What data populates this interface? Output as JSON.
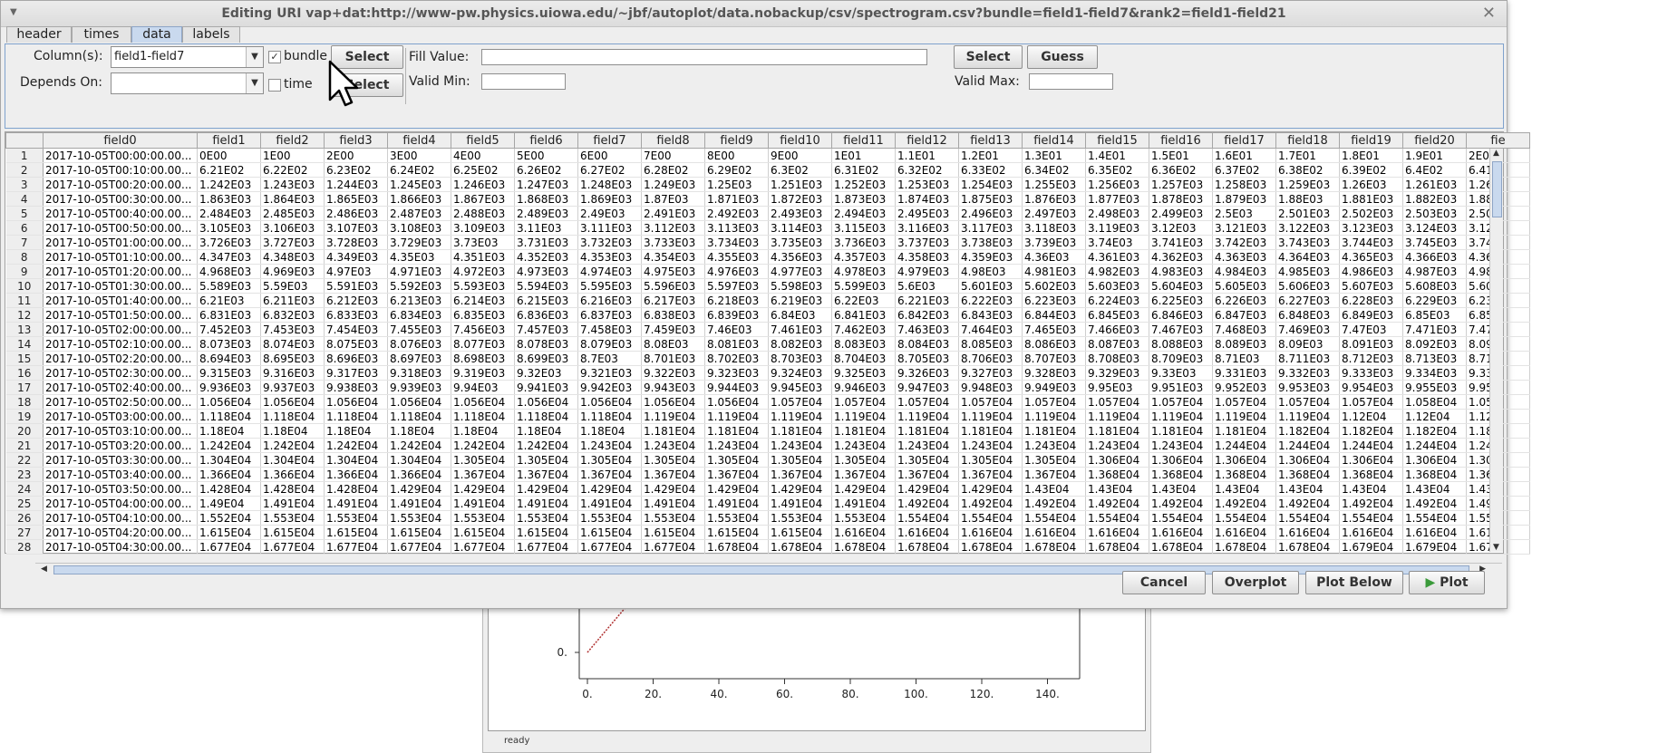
{
  "background_window": {
    "y_tick": "0.",
    "x_ticks": [
      "0.",
      "20.",
      "40.",
      "60.",
      "80.",
      "100.",
      "120.",
      "140."
    ],
    "status": "ready"
  },
  "dialog": {
    "title": "Editing URI vap+dat:http://www-pw.physics.uiowa.edu/~jbf/autoplot/data.nobackup/csv/spectrogram.csv?bundle=field1-field7&rank2=field1-field21",
    "tabs": [
      "header",
      "times",
      "data",
      "labels"
    ],
    "active_tab": "data",
    "columns_label": "Column(s):",
    "columns_value": "field1-field7",
    "bundle_label": "bundle",
    "bundle_checked": true,
    "select_label": "Select",
    "select2_label": "Select",
    "depends_on_label": "Depends On:",
    "depends_on_value": "",
    "time_label": "time",
    "time_checked": false,
    "fill_value_label": "Fill Value:",
    "fill_value": "",
    "fill_select_label": "Select",
    "guess_label": "Guess",
    "valid_min_label": "Valid Min:",
    "valid_max_label": "Valid Max:",
    "cancel_label": "Cancel",
    "overplot_label": "Overplot",
    "plot_below_label": "Plot Below",
    "plot_label": "Plot",
    "accent_color": "#c9d9ee"
  },
  "table": {
    "headers": [
      "field0",
      "field1",
      "field2",
      "field3",
      "field4",
      "field5",
      "field6",
      "field7",
      "field8",
      "field9",
      "field10",
      "field11",
      "field12",
      "field13",
      "field14",
      "field15",
      "field16",
      "field17",
      "field18",
      "field19",
      "field20",
      "fie"
    ],
    "rows": [
      [
        "2017-10-05T00:00:00.00...",
        "0E00",
        "1E00",
        "2E00",
        "3E00",
        "4E00",
        "5E00",
        "6E00",
        "7E00",
        "8E00",
        "9E00",
        "1E01",
        "1.1E01",
        "1.2E01",
        "1.3E01",
        "1.4E01",
        "1.5E01",
        "1.6E01",
        "1.7E01",
        "1.8E01",
        "1.9E01",
        "2E0"
      ],
      [
        "2017-10-05T00:10:00.00...",
        "6.21E02",
        "6.22E02",
        "6.23E02",
        "6.24E02",
        "6.25E02",
        "6.26E02",
        "6.27E02",
        "6.28E02",
        "6.29E02",
        "6.3E02",
        "6.31E02",
        "6.32E02",
        "6.33E02",
        "6.34E02",
        "6.35E02",
        "6.36E02",
        "6.37E02",
        "6.38E02",
        "6.39E02",
        "6.4E02",
        "6.41"
      ],
      [
        "2017-10-05T00:20:00.00...",
        "1.242E03",
        "1.243E03",
        "1.244E03",
        "1.245E03",
        "1.246E03",
        "1.247E03",
        "1.248E03",
        "1.249E03",
        "1.25E03",
        "1.251E03",
        "1.252E03",
        "1.253E03",
        "1.254E03",
        "1.255E03",
        "1.256E03",
        "1.257E03",
        "1.258E03",
        "1.259E03",
        "1.26E03",
        "1.261E03",
        "1.26"
      ],
      [
        "2017-10-05T00:30:00.00...",
        "1.863E03",
        "1.864E03",
        "1.865E03",
        "1.866E03",
        "1.867E03",
        "1.868E03",
        "1.869E03",
        "1.87E03",
        "1.871E03",
        "1.872E03",
        "1.873E03",
        "1.874E03",
        "1.875E03",
        "1.876E03",
        "1.877E03",
        "1.878E03",
        "1.879E03",
        "1.88E03",
        "1.881E03",
        "1.882E03",
        "1.88"
      ],
      [
        "2017-10-05T00:40:00.00...",
        "2.484E03",
        "2.485E03",
        "2.486E03",
        "2.487E03",
        "2.488E03",
        "2.489E03",
        "2.49E03",
        "2.491E03",
        "2.492E03",
        "2.493E03",
        "2.494E03",
        "2.495E03",
        "2.496E03",
        "2.497E03",
        "2.498E03",
        "2.499E03",
        "2.5E03",
        "2.501E03",
        "2.502E03",
        "2.503E03",
        "2.50"
      ],
      [
        "2017-10-05T00:50:00.00...",
        "3.105E03",
        "3.106E03",
        "3.107E03",
        "3.108E03",
        "3.109E03",
        "3.11E03",
        "3.111E03",
        "3.112E03",
        "3.113E03",
        "3.114E03",
        "3.115E03",
        "3.116E03",
        "3.117E03",
        "3.118E03",
        "3.119E03",
        "3.12E03",
        "3.121E03",
        "3.122E03",
        "3.123E03",
        "3.124E03",
        "3.12"
      ],
      [
        "2017-10-05T01:00:00.00...",
        "3.726E03",
        "3.727E03",
        "3.728E03",
        "3.729E03",
        "3.73E03",
        "3.731E03",
        "3.732E03",
        "3.733E03",
        "3.734E03",
        "3.735E03",
        "3.736E03",
        "3.737E03",
        "3.738E03",
        "3.739E03",
        "3.74E03",
        "3.741E03",
        "3.742E03",
        "3.743E03",
        "3.744E03",
        "3.745E03",
        "3.74"
      ],
      [
        "2017-10-05T01:10:00.00...",
        "4.347E03",
        "4.348E03",
        "4.349E03",
        "4.35E03",
        "4.351E03",
        "4.352E03",
        "4.353E03",
        "4.354E03",
        "4.355E03",
        "4.356E03",
        "4.357E03",
        "4.358E03",
        "4.359E03",
        "4.36E03",
        "4.361E03",
        "4.362E03",
        "4.363E03",
        "4.364E03",
        "4.365E03",
        "4.366E03",
        "4.36"
      ],
      [
        "2017-10-05T01:20:00.00...",
        "4.968E03",
        "4.969E03",
        "4.97E03",
        "4.971E03",
        "4.972E03",
        "4.973E03",
        "4.974E03",
        "4.975E03",
        "4.976E03",
        "4.977E03",
        "4.978E03",
        "4.979E03",
        "4.98E03",
        "4.981E03",
        "4.982E03",
        "4.983E03",
        "4.984E03",
        "4.985E03",
        "4.986E03",
        "4.987E03",
        "4.98"
      ],
      [
        "2017-10-05T01:30:00.00...",
        "5.589E03",
        "5.59E03",
        "5.591E03",
        "5.592E03",
        "5.593E03",
        "5.594E03",
        "5.595E03",
        "5.596E03",
        "5.597E03",
        "5.598E03",
        "5.599E03",
        "5.6E03",
        "5.601E03",
        "5.602E03",
        "5.603E03",
        "5.604E03",
        "5.605E03",
        "5.606E03",
        "5.607E03",
        "5.608E03",
        "5.60"
      ],
      [
        "2017-10-05T01:40:00.00...",
        "6.21E03",
        "6.211E03",
        "6.212E03",
        "6.213E03",
        "6.214E03",
        "6.215E03",
        "6.216E03",
        "6.217E03",
        "6.218E03",
        "6.219E03",
        "6.22E03",
        "6.221E03",
        "6.222E03",
        "6.223E03",
        "6.224E03",
        "6.225E03",
        "6.226E03",
        "6.227E03",
        "6.228E03",
        "6.229E03",
        "6.23"
      ],
      [
        "2017-10-05T01:50:00.00...",
        "6.831E03",
        "6.832E03",
        "6.833E03",
        "6.834E03",
        "6.835E03",
        "6.836E03",
        "6.837E03",
        "6.838E03",
        "6.839E03",
        "6.84E03",
        "6.841E03",
        "6.842E03",
        "6.843E03",
        "6.844E03",
        "6.845E03",
        "6.846E03",
        "6.847E03",
        "6.848E03",
        "6.849E03",
        "6.85E03",
        "6.85"
      ],
      [
        "2017-10-05T02:00:00.00...",
        "7.452E03",
        "7.453E03",
        "7.454E03",
        "7.455E03",
        "7.456E03",
        "7.457E03",
        "7.458E03",
        "7.459E03",
        "7.46E03",
        "7.461E03",
        "7.462E03",
        "7.463E03",
        "7.464E03",
        "7.465E03",
        "7.466E03",
        "7.467E03",
        "7.468E03",
        "7.469E03",
        "7.47E03",
        "7.471E03",
        "7.47"
      ],
      [
        "2017-10-05T02:10:00.00...",
        "8.073E03",
        "8.074E03",
        "8.075E03",
        "8.076E03",
        "8.077E03",
        "8.078E03",
        "8.079E03",
        "8.08E03",
        "8.081E03",
        "8.082E03",
        "8.083E03",
        "8.084E03",
        "8.085E03",
        "8.086E03",
        "8.087E03",
        "8.088E03",
        "8.089E03",
        "8.09E03",
        "8.091E03",
        "8.092E03",
        "8.09"
      ],
      [
        "2017-10-05T02:20:00.00...",
        "8.694E03",
        "8.695E03",
        "8.696E03",
        "8.697E03",
        "8.698E03",
        "8.699E03",
        "8.7E03",
        "8.701E03",
        "8.702E03",
        "8.703E03",
        "8.704E03",
        "8.705E03",
        "8.706E03",
        "8.707E03",
        "8.708E03",
        "8.709E03",
        "8.71E03",
        "8.711E03",
        "8.712E03",
        "8.713E03",
        "8.71"
      ],
      [
        "2017-10-05T02:30:00.00...",
        "9.315E03",
        "9.316E03",
        "9.317E03",
        "9.318E03",
        "9.319E03",
        "9.32E03",
        "9.321E03",
        "9.322E03",
        "9.323E03",
        "9.324E03",
        "9.325E03",
        "9.326E03",
        "9.327E03",
        "9.328E03",
        "9.329E03",
        "9.33E03",
        "9.331E03",
        "9.332E03",
        "9.333E03",
        "9.334E03",
        "9.33"
      ],
      [
        "2017-10-05T02:40:00.00...",
        "9.936E03",
        "9.937E03",
        "9.938E03",
        "9.939E03",
        "9.94E03",
        "9.941E03",
        "9.942E03",
        "9.943E03",
        "9.944E03",
        "9.945E03",
        "9.946E03",
        "9.947E03",
        "9.948E03",
        "9.949E03",
        "9.95E03",
        "9.951E03",
        "9.952E03",
        "9.953E03",
        "9.954E03",
        "9.955E03",
        "9.95"
      ],
      [
        "2017-10-05T02:50:00.00...",
        "1.056E04",
        "1.056E04",
        "1.056E04",
        "1.056E04",
        "1.056E04",
        "1.056E04",
        "1.056E04",
        "1.056E04",
        "1.056E04",
        "1.057E04",
        "1.057E04",
        "1.057E04",
        "1.057E04",
        "1.057E04",
        "1.057E04",
        "1.057E04",
        "1.057E04",
        "1.057E04",
        "1.057E04",
        "1.058E04",
        "1.05"
      ],
      [
        "2017-10-05T03:00:00.00...",
        "1.118E04",
        "1.118E04",
        "1.118E04",
        "1.118E04",
        "1.118E04",
        "1.118E04",
        "1.118E04",
        "1.119E04",
        "1.119E04",
        "1.119E04",
        "1.119E04",
        "1.119E04",
        "1.119E04",
        "1.119E04",
        "1.119E04",
        "1.119E04",
        "1.119E04",
        "1.119E04",
        "1.12E04",
        "1.12E04",
        "1.12"
      ],
      [
        "2017-10-05T03:10:00.00...",
        "1.18E04",
        "1.18E04",
        "1.18E04",
        "1.18E04",
        "1.18E04",
        "1.18E04",
        "1.18E04",
        "1.181E04",
        "1.181E04",
        "1.181E04",
        "1.181E04",
        "1.181E04",
        "1.181E04",
        "1.181E04",
        "1.181E04",
        "1.181E04",
        "1.181E04",
        "1.182E04",
        "1.182E04",
        "1.182E04",
        "1.18"
      ],
      [
        "2017-10-05T03:20:00.00...",
        "1.242E04",
        "1.242E04",
        "1.242E04",
        "1.242E04",
        "1.242E04",
        "1.242E04",
        "1.243E04",
        "1.243E04",
        "1.243E04",
        "1.243E04",
        "1.243E04",
        "1.243E04",
        "1.243E04",
        "1.243E04",
        "1.243E04",
        "1.243E04",
        "1.244E04",
        "1.244E04",
        "1.244E04",
        "1.244E04",
        "1.24"
      ],
      [
        "2017-10-05T03:30:00.00...",
        "1.304E04",
        "1.304E04",
        "1.304E04",
        "1.304E04",
        "1.305E04",
        "1.305E04",
        "1.305E04",
        "1.305E04",
        "1.305E04",
        "1.305E04",
        "1.305E04",
        "1.305E04",
        "1.305E04",
        "1.305E04",
        "1.306E04",
        "1.306E04",
        "1.306E04",
        "1.306E04",
        "1.306E04",
        "1.306E04",
        "1.30"
      ],
      [
        "2017-10-05T03:40:00.00...",
        "1.366E04",
        "1.366E04",
        "1.366E04",
        "1.366E04",
        "1.367E04",
        "1.367E04",
        "1.367E04",
        "1.367E04",
        "1.367E04",
        "1.367E04",
        "1.367E04",
        "1.367E04",
        "1.367E04",
        "1.367E04",
        "1.368E04",
        "1.368E04",
        "1.368E04",
        "1.368E04",
        "1.368E04",
        "1.368E04",
        "1.36"
      ],
      [
        "2017-10-05T03:50:00.00...",
        "1.428E04",
        "1.428E04",
        "1.428E04",
        "1.429E04",
        "1.429E04",
        "1.429E04",
        "1.429E04",
        "1.429E04",
        "1.429E04",
        "1.429E04",
        "1.429E04",
        "1.429E04",
        "1.429E04",
        "1.43E04",
        "1.43E04",
        "1.43E04",
        "1.43E04",
        "1.43E04",
        "1.43E04",
        "1.43E04",
        "1.43"
      ],
      [
        "2017-10-05T04:00:00.00...",
        "1.49E04",
        "1.491E04",
        "1.491E04",
        "1.491E04",
        "1.491E04",
        "1.491E04",
        "1.491E04",
        "1.491E04",
        "1.491E04",
        "1.491E04",
        "1.491E04",
        "1.492E04",
        "1.492E04",
        "1.492E04",
        "1.492E04",
        "1.492E04",
        "1.492E04",
        "1.492E04",
        "1.492E04",
        "1.492E04",
        "1.49"
      ],
      [
        "2017-10-05T04:10:00.00...",
        "1.552E04",
        "1.553E04",
        "1.553E04",
        "1.553E04",
        "1.553E04",
        "1.553E04",
        "1.553E04",
        "1.553E04",
        "1.553E04",
        "1.553E04",
        "1.553E04",
        "1.554E04",
        "1.554E04",
        "1.554E04",
        "1.554E04",
        "1.554E04",
        "1.554E04",
        "1.554E04",
        "1.554E04",
        "1.554E04",
        "1.55"
      ],
      [
        "2017-10-05T04:20:00.00...",
        "1.615E04",
        "1.615E04",
        "1.615E04",
        "1.615E04",
        "1.615E04",
        "1.615E04",
        "1.615E04",
        "1.615E04",
        "1.615E04",
        "1.615E04",
        "1.616E04",
        "1.616E04",
        "1.616E04",
        "1.616E04",
        "1.616E04",
        "1.616E04",
        "1.616E04",
        "1.616E04",
        "1.616E04",
        "1.616E04",
        "1.61"
      ],
      [
        "2017-10-05T04:30:00.00...",
        "1.677E04",
        "1.677E04",
        "1.677E04",
        "1.677E04",
        "1.677E04",
        "1.677E04",
        "1.677E04",
        "1.677E04",
        "1.678E04",
        "1.678E04",
        "1.678E04",
        "1.678E04",
        "1.678E04",
        "1.678E04",
        "1.678E04",
        "1.678E04",
        "1.678E04",
        "1.678E04",
        "1.679E04",
        "1.679E04",
        "1.67"
      ]
    ]
  }
}
